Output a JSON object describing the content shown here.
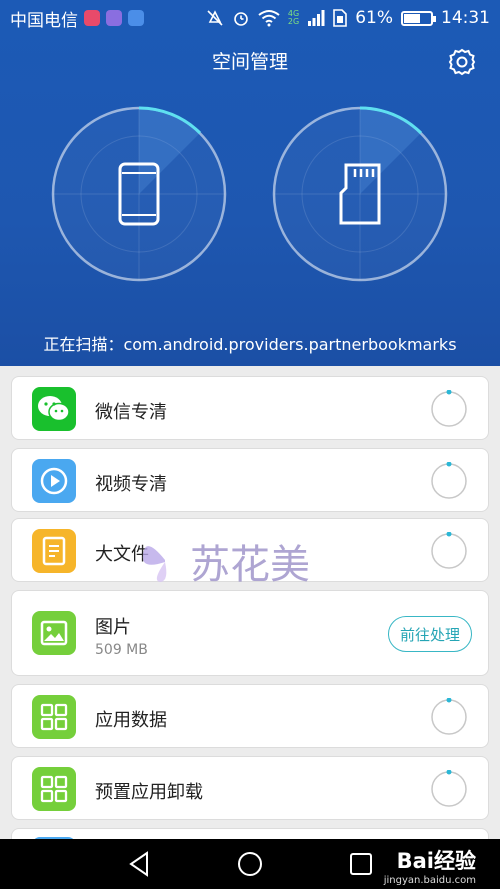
{
  "status_bar": {
    "carrier": "中国电信",
    "network_badge_top": "4G",
    "network_badge_bottom": "2G",
    "battery_percent": "61%",
    "battery_level": 0.61,
    "time": "14:31"
  },
  "header": {
    "title": "空间管理"
  },
  "gauges": [
    {
      "name": "phone-storage",
      "icon": "phone-icon"
    },
    {
      "name": "sd-card",
      "icon": "sd-card-icon"
    }
  ],
  "scan": {
    "status_text": "正在扫描：com.android.providers.partnerbookmarks"
  },
  "list": {
    "items": [
      {
        "title": "微信专清",
        "icon": "wechat-icon",
        "color": "#19c02d"
      },
      {
        "title": "视频专清",
        "icon": "video-play-icon",
        "color": "#4aa8f0"
      },
      {
        "title": "大文件",
        "icon": "document-icon",
        "color": "#f6b52a"
      },
      {
        "title": "图片",
        "subtitle": "509 MB",
        "action": "前往处理",
        "icon": "image-icon",
        "color": "#75cf3b"
      },
      {
        "title": "应用数据",
        "icon": "grid-icon",
        "color": "#75cf3b"
      },
      {
        "title": "预置应用卸载",
        "icon": "grid-icon",
        "color": "#75cf3b"
      }
    ]
  },
  "watermark": {
    "text": "苏花美"
  },
  "baidu": {
    "brand": "Bai经验",
    "url": "jingyan.baidu.com"
  },
  "colors": {
    "header_bg": "#1c5ab6",
    "accent_cyan": "#39b7c5"
  }
}
